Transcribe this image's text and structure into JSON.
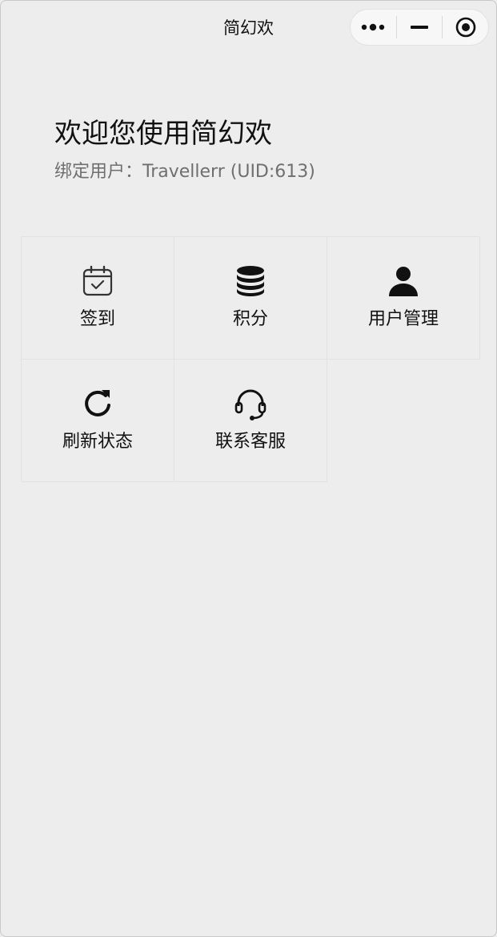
{
  "window": {
    "title": "简幻欢",
    "capsule_icons": [
      "more-icon",
      "minimize-icon",
      "close-circle-icon"
    ]
  },
  "header": {
    "welcome": "欢迎您使用简幻欢",
    "bind_prefix": "绑定用户：",
    "bind_user": "Travellerr (UID:613)"
  },
  "grid": {
    "items": [
      {
        "label": "签到",
        "icon": "calendar-check-icon"
      },
      {
        "label": "积分",
        "icon": "database-icon"
      },
      {
        "label": "用户管理",
        "icon": "user-icon"
      },
      {
        "label": "刷新状态",
        "icon": "refresh-icon"
      },
      {
        "label": "联系客服",
        "icon": "headset-icon"
      }
    ]
  }
}
